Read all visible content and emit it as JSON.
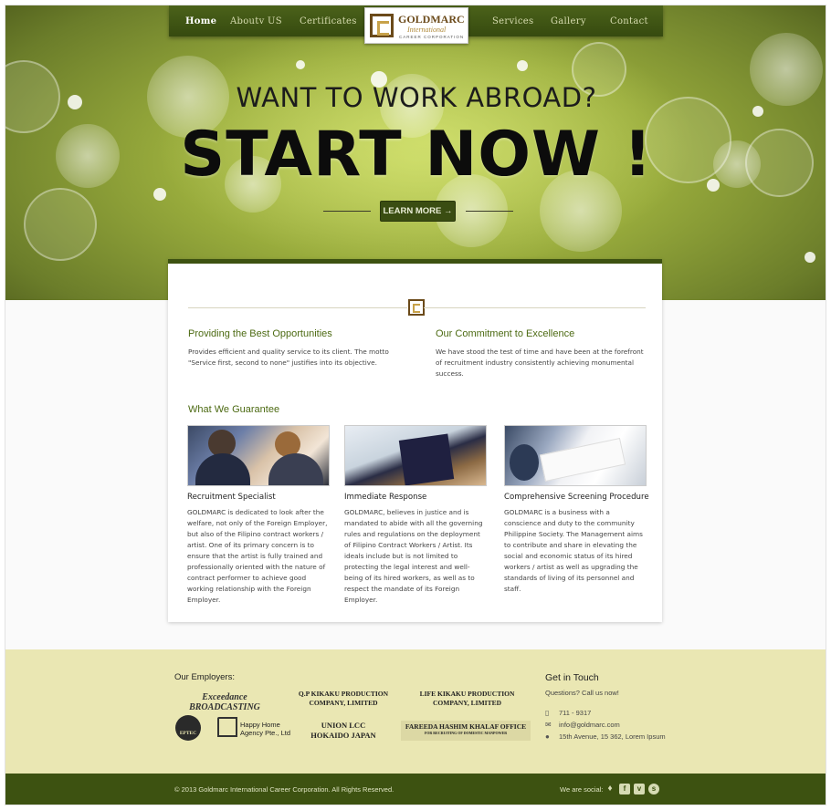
{
  "nav": {
    "items": [
      {
        "label": "Home"
      },
      {
        "label": "Aboutv US"
      },
      {
        "label": "Certificates"
      },
      {
        "label": "Services"
      },
      {
        "label": "Gallery"
      },
      {
        "label": "Contact"
      }
    ],
    "active": "Home"
  },
  "logo": {
    "name": "GOLDMARC",
    "sub1": "International",
    "sub2": "CAREER CORPORATION"
  },
  "hero": {
    "line1": "WANT TO WORK ABROAD?",
    "line2": "START NOW !",
    "button": "LEARN MORE →"
  },
  "intro": [
    {
      "title": "Providing the Best Opportunities",
      "text": "Provides efficient and quality service to its client. The motto \"Service first, second to none\" justifies into its objective."
    },
    {
      "title": "Our Commitment to Excellence",
      "text": "We have stood the test of time and have been at the forefront of recruitment industry consistently achieving monumental success."
    }
  ],
  "guarantee": {
    "title": "What We Guarantee",
    "items": [
      {
        "title": "Recruitment Specialist",
        "text": "GOLDMARC is dedicated to look after the welfare, not only of the Foreign Employer, but also of the Filipino contract workers / artist. One of its primary concern is to ensure that the artist is fully trained and professionally oriented with the nature of contract performer to achieve good working relationship with the Foreign Employer."
      },
      {
        "title": "Immediate Response",
        "text": "GOLDMARC, believes in justice and is mandated to abide with all the governing rules and regulations on the deployment of Filipino Contract Workers / Artist. Its ideals include but is not limited to protecting the legal interest and well-being of its hired workers, as well as to respect the mandate of its Foreign Employer."
      },
      {
        "title": "Comprehensive Screening Procedure",
        "text": " GOLDMARC is a business with a conscience and duty to the community Philippine Society. The Management aims to contribute and share in elevating the social and economic status of its hired workers / artist as well as upgrading the standards of living of its personnel and staff."
      }
    ]
  },
  "employers": {
    "title": "Our Employers:",
    "logos": [
      {
        "line1": "Exceedance BROADCASTING"
      },
      {
        "line1": "Q.P KIKAKU PRODUCTION",
        "line2": "COMPANY, LIMITED"
      },
      {
        "line1": "LIFE KIKAKU PRODUCTION",
        "line2": "COMPANY, LIMITED"
      },
      {
        "line1": "EPTEC"
      },
      {
        "line1": "Happy Home",
        "line2": "Agency Pte., Ltd"
      },
      {
        "line1": "UNION LCC",
        "line2": "HOKAIDO JAPAN"
      },
      {
        "line1": "FAREEDA HASHIM KHALAF OFFICE",
        "line2": "FOR RECRUITING OF DOMESTIC MANPOWER"
      }
    ]
  },
  "contact": {
    "title": "Get in Touch",
    "subtitle": "Questions?  Call us now!",
    "phone": "711 - 9317",
    "email": "info@goldmarc.com",
    "address": "15th Avenue, 15 362, Lorem Ipsum"
  },
  "footer": {
    "copyright": "© 2013 Goldmarc International Career Corporation. All Rights Reserved.",
    "social_label": "We are social:",
    "social_icons": [
      "twitter-icon",
      "facebook-icon",
      "vimeo-icon",
      "stumbleupon-icon"
    ]
  }
}
